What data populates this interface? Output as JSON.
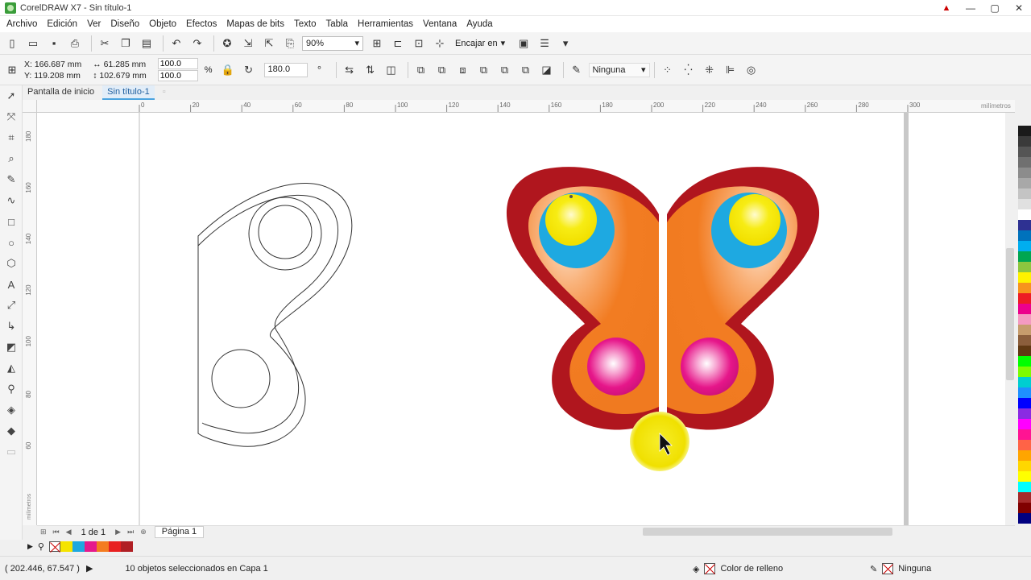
{
  "window": {
    "title": "CorelDRAW X7 - Sin título-1"
  },
  "menu": [
    "Archivo",
    "Edición",
    "Ver",
    "Diseño",
    "Objeto",
    "Efectos",
    "Mapas de bits",
    "Texto",
    "Tabla",
    "Herramientas",
    "Ventana",
    "Ayuda"
  ],
  "toolbar": {
    "zoom": "90%",
    "fit_label": "Encajar en"
  },
  "props": {
    "x": "X: 166.687 mm",
    "y": "Y: 119.208 mm",
    "width": "61.285 mm",
    "height": "102.679 mm",
    "scale_x": "100.0",
    "scale_y": "100.0",
    "pct": "%",
    "rotation": "180.0",
    "outline": "Ninguna"
  },
  "tabs": [
    "Pantalla de inicio",
    "Sin título-1"
  ],
  "ruler": {
    "h_ticks": [
      "0",
      "20",
      "40",
      "60",
      "80",
      "100",
      "120",
      "140",
      "160",
      "180",
      "200",
      "220",
      "240",
      "260",
      "280",
      "300",
      "milímetros"
    ],
    "v_ticks": [
      "180",
      "160",
      "140",
      "120",
      "100",
      "80",
      "60",
      "milímetros"
    ]
  },
  "page_nav": {
    "counter": "1 de 1",
    "page_tab": "Página 1"
  },
  "status": {
    "coords": "( 202.446, 67.547 )",
    "message": "10 objetos seleccionados en Capa 1",
    "fill_label": "Color de relleno",
    "outline_label": "Ninguna"
  },
  "colors": {
    "palette": [
      "#1a1a1a",
      "#3a3a3a",
      "#555555",
      "#707070",
      "#8c8c8c",
      "#a8a8a8",
      "#c4c4c4",
      "#e0e0e0",
      "#ffffff",
      "#2e3192",
      "#0072bc",
      "#00aeef",
      "#00a651",
      "#8dc63f",
      "#fff200",
      "#f7941d",
      "#ed1c24",
      "#ec008c",
      "#f49ac1",
      "#c69c6d",
      "#8b5e3c",
      "#603913",
      "#00ff00",
      "#7cfc00",
      "#00ced1",
      "#1e90ff",
      "#0000ff",
      "#8a2be2",
      "#ff00ff",
      "#ff1493",
      "#ff6347",
      "#ffa500",
      "#ffd700",
      "#ffff00",
      "#00ffff",
      "#a52a2a",
      "#800000",
      "#000080"
    ],
    "doc_palette": [
      "#f5e400",
      "#1ea8e0",
      "#e5198c",
      "#f47c20",
      "#e82020",
      "#b01f24"
    ],
    "wing_dark": "#b0161e",
    "wing_orange": "#f27c22",
    "blue_spot": "#1ea9e1",
    "yellow_spot": "#f7ec14",
    "pink_spot": "#e6168a"
  }
}
